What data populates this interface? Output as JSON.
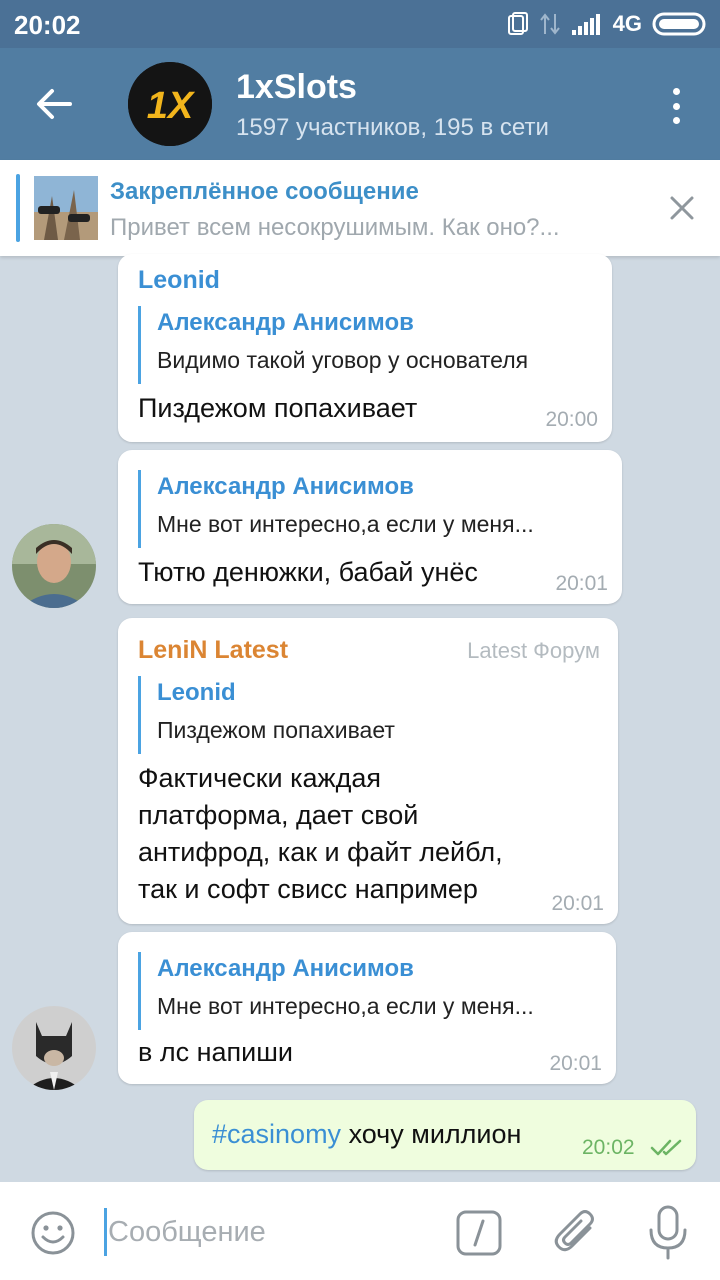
{
  "status_bar": {
    "time": "20:02",
    "network": "4G"
  },
  "header": {
    "title": "1xSlots",
    "subtitle": "1597 участников, 195 в сети",
    "avatar_logo": "1X"
  },
  "pinned": {
    "title": "Закреплённое сообщение",
    "text": "Привет всем несокрушимым.   Как оно?..."
  },
  "messages": [
    {
      "sender": "Leonid",
      "reply_name": "Александр Анисимов",
      "reply_text": "Видимо такой уговор у основателя",
      "text": "Пиздежом попахивает",
      "time": "20:00"
    },
    {
      "reply_name": "Александр Анисимов",
      "reply_text": "Мне вот интересно,а если у меня...",
      "text": "Тютю денюжки, бабай унёс",
      "time": "20:01"
    },
    {
      "sender": "LeniN Latest",
      "signature": "Latest Форум",
      "reply_name": "Leonid",
      "reply_text": "Пиздежом попахивает",
      "text": "Фактически каждая\nплатформа, дает свой\nантифрод, как и файт лейбл,\nтак и софт свисс например",
      "time": "20:01"
    },
    {
      "reply_name": "Александр Анисимов",
      "reply_text": "Мне вот интересно,а если у меня...",
      "text": "в лс напиши",
      "time": "20:01"
    }
  ],
  "outgoing": {
    "hashtag": "#casinomy",
    "text": " хочу миллион",
    "time": "20:02"
  },
  "input": {
    "placeholder": "Сообщение"
  },
  "colors": {
    "header": "#517da2",
    "status_bar": "#4b7196",
    "link": "#3a8fd4",
    "orange_name": "#db8533",
    "outgoing_bubble": "#effdde",
    "chat_bg": "#cfd9e2"
  }
}
